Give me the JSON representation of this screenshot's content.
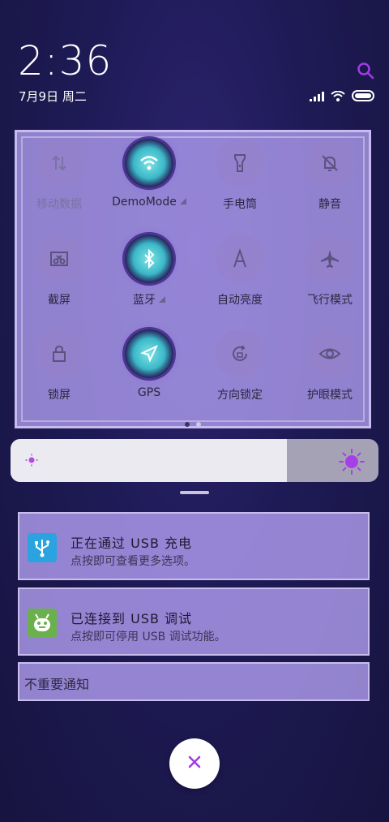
{
  "header": {
    "time": "2:36",
    "date": "7月9日 周二"
  },
  "quick_settings": {
    "tiles": [
      {
        "label": "移动数据",
        "icon": "data-arrows-icon",
        "active": false,
        "dim": true
      },
      {
        "label": "DemoMode",
        "icon": "wifi-icon",
        "active": true,
        "expand": true
      },
      {
        "label": "手电筒",
        "icon": "flashlight-icon",
        "active": false
      },
      {
        "label": "静音",
        "icon": "bell-off-icon",
        "active": false
      },
      {
        "label": "截屏",
        "icon": "screenshot-icon",
        "active": false
      },
      {
        "label": "蓝牙",
        "icon": "bluetooth-icon",
        "active": true,
        "expand": true
      },
      {
        "label": "自动亮度",
        "icon": "auto-brightness-icon",
        "active": false
      },
      {
        "label": "飞行模式",
        "icon": "airplane-icon",
        "active": false
      },
      {
        "label": "锁屏",
        "icon": "lock-icon",
        "active": false
      },
      {
        "label": "GPS",
        "icon": "location-arrow-icon",
        "active": true
      },
      {
        "label": "方向锁定",
        "icon": "rotation-lock-icon",
        "active": false
      },
      {
        "label": "护眼模式",
        "icon": "eye-icon",
        "active": false
      }
    ],
    "page_count": 2,
    "current_page": 1
  },
  "brightness": {
    "level": 0.75
  },
  "notifications": [
    {
      "title": "正在通过 USB 充电",
      "body": "点按即可查看更多选项。",
      "icon": "usb-icon",
      "icon_color": "#2aa3e0"
    },
    {
      "title": "已连接到 USB 调试",
      "body": "点按即可停用 USB 调试功能。",
      "icon": "android-icon",
      "icon_color": "#6ab04c"
    }
  ],
  "minor_notifications": {
    "label": "不重要通知"
  },
  "colors": {
    "accent": "#9b3fe0",
    "panel": "#bfaaff"
  }
}
